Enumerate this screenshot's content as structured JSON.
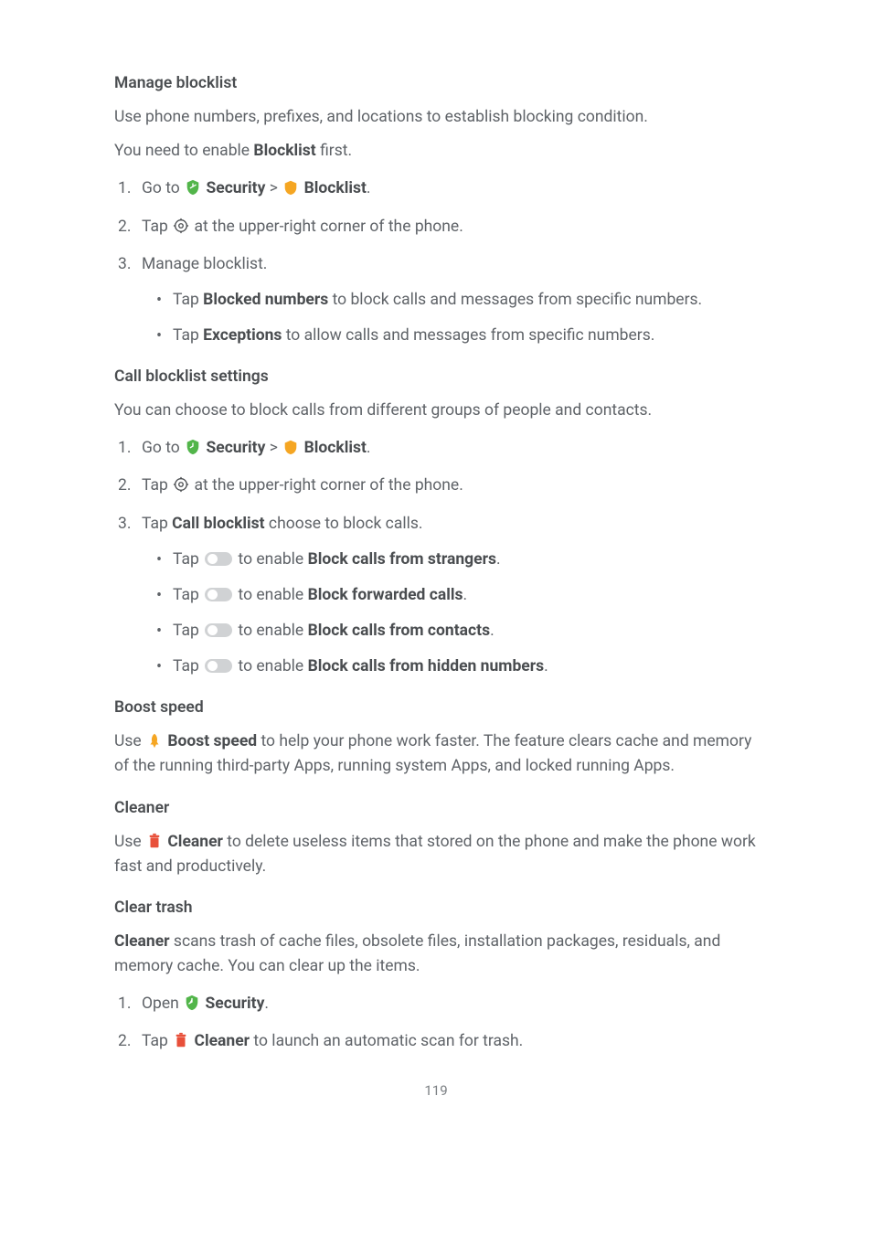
{
  "sections": {
    "manage_blocklist": {
      "title": "Manage blocklist",
      "intro": "Use phone numbers, prefixes, and locations to establish blocking condition.",
      "note_prefix": "You need to enable ",
      "note_bold": "Blocklist",
      "note_suffix": " first.",
      "steps": {
        "s1_prefix": "Go to ",
        "s1_security": "Security",
        "s1_sep": " > ",
        "s1_blocklist": "Blocklist",
        "s1_suffix": ".",
        "s2_prefix": "Tap ",
        "s2_suffix": " at the upper-right corner of the phone.",
        "s3": "Manage blocklist.",
        "s3a_prefix": "Tap ",
        "s3a_bold": "Blocked numbers",
        "s3a_suffix": " to block calls and messages from specific numbers.",
        "s3b_prefix": "Tap ",
        "s3b_bold": "Exceptions",
        "s3b_suffix": " to allow calls and messages from specific numbers."
      }
    },
    "call_blocklist": {
      "title": "Call blocklist settings",
      "intro": "You can choose to block calls from different groups of people and contacts.",
      "steps": {
        "s1_prefix": "Go to ",
        "s1_security": "Security",
        "s1_sep": " > ",
        "s1_blocklist": "Blocklist",
        "s1_suffix": ".",
        "s2_prefix": "Tap ",
        "s2_suffix": " at the upper-right corner of the phone.",
        "s3_prefix": "Tap ",
        "s3_bold": "Call blocklist",
        "s3_suffix": " choose to block calls.",
        "t_prefix": "Tap ",
        "t_mid": " to enable ",
        "t1_bold": "Block calls from strangers",
        "t2_bold": "Block forwarded calls",
        "t3_bold": "Block calls from contacts",
        "t4_bold": "Block calls from hidden numbers",
        "t_suffix": "."
      }
    },
    "boost_speed": {
      "title": "Boost speed",
      "p_prefix": "Use ",
      "p_bold": "Boost speed",
      "p_suffix": " to help your phone work faster. The feature clears cache and memory of the running third-party Apps, running system Apps, and locked running Apps."
    },
    "cleaner": {
      "title": "Cleaner",
      "p_prefix": "Use ",
      "p_bold": "Cleaner",
      "p_suffix": " to delete useless items that stored on the phone and make the phone work fast and productively."
    },
    "clear_trash": {
      "title": "Clear trash",
      "p_bold": "Cleaner",
      "p_suffix": " scans trash of cache files, obsolete files, installation packages, residuals, and memory cache. You can clear up the items.",
      "steps": {
        "s1_prefix": "Open ",
        "s1_bold": "Security",
        "s1_suffix": ".",
        "s2_prefix": "Tap ",
        "s2_bold": "Cleaner",
        "s2_suffix": " to launch an automatic scan for trash."
      }
    }
  },
  "page_number": "119"
}
